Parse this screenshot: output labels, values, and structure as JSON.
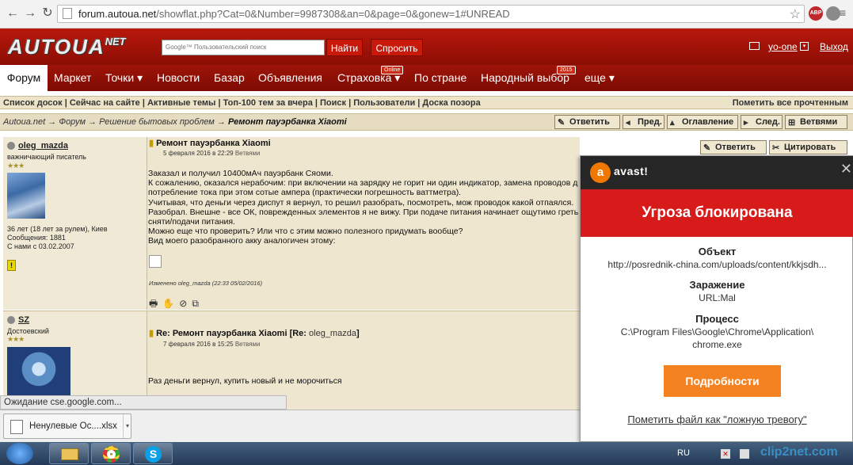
{
  "browser": {
    "url_host": "forum.autoua.net",
    "url_rest": "/showflat.php?Cat=0&Number=9987308&an=0&page=0&gonew=1#UNREAD",
    "ext_abp": "ABP"
  },
  "header": {
    "logo_main": "AUTOUA",
    "logo_sup": "NET",
    "search_placeholder": "Google™ Пользовательский поиск",
    "find_button": "Найти",
    "ask_button": "Спросить",
    "user": "yo-one",
    "logout": "Выход"
  },
  "nav": {
    "items": [
      {
        "label": "Форум"
      },
      {
        "label": "Маркет"
      },
      {
        "label": "Точки ▾"
      },
      {
        "label": "Новости"
      },
      {
        "label": "Базар"
      },
      {
        "label": "Объявления"
      },
      {
        "label": "Страховка ▾",
        "badge": "Online"
      },
      {
        "label": "По стране"
      },
      {
        "label": "Народный выбор",
        "badge": "2015"
      },
      {
        "label": "еще ▾"
      }
    ]
  },
  "linksbar": {
    "left": "Список досок | Сейчас на сайте | Активные темы | Топ-100 тем за вчера | Поиск | Пользователи | Доска позора",
    "right": "Пометить все прочтенным"
  },
  "breadcrumb": {
    "path": "Autoua.net → Форум → Решение бытовых проблем → ",
    "current": "Ремонт пауэрбанка Xiaomi",
    "buttons": [
      "Ответить",
      "Пред.",
      "Оглавление",
      "След.",
      "Ветвями"
    ]
  },
  "post1": {
    "author": "oleg_mazda",
    "rank": "важничающий писатель",
    "info": [
      "36 лет (18 лет за рулем), Киев",
      "Сообщения: 1881",
      "С нами с 03.02.2007"
    ],
    "title": "Ремонт пауэрбанка Xiaomi",
    "date": "5 февраля 2016 в 22:29 ",
    "date_link": "Ветвями",
    "reply_btn": "Ответить",
    "quote_btn": "Цитировать",
    "body": [
      "Заказал и получил 10400мАч пауэрбанк Сяоми.",
      "К сожалению, оказался нерабочим: при включении на зарядку не горит ни один индикатор, замена проводов д",
      "потребление тока при этом сотые ампера (практически погрешность ваттметра).",
      "Учитывая, что деньги через диспут я вернул, то решил разобрать, посмотреть, мож проводок какой отпаялся.",
      "Разобрал. Внешне - все ОК, поврежденных элементов я не вижу. При подаче питания начинает ощутимо греть",
      "сняти/подачи питания.",
      "Можно еще что проверить? Или что с этим можно полезного придумать вообще?",
      "Вид моего разобранного акку аналогичен этому:"
    ],
    "edited": "Изменено oleg_mazda (22:33 05/02/2016)"
  },
  "post2": {
    "author": "SZ",
    "rank": "Достоевский",
    "title": "Re: Ремонт пауэрбанка Xiaomi [Re: ",
    "title_user": "oleg_mazda",
    "title_end": "]",
    "date": "7 февраля 2016 в 15:25 ",
    "date_link": "Ветвями",
    "body": "Раз деньги вернул, купить новый и не морочиться"
  },
  "status": "Ожидание cse.google.com...",
  "download": {
    "filename": "Ненулевые Ос....xlsx"
  },
  "taskbar": {
    "lang": "RU"
  },
  "avast": {
    "brand": "avast!",
    "headline": "Угроза блокирована",
    "object_label": "Объект",
    "object_value": "http://posrednik-china.com/uploads/content/kkjsdh...",
    "infection_label": "Заражение",
    "infection_value": "URL:Mal",
    "process_label": "Процесс",
    "process_value_1": "C:\\Program Files\\Google\\Chrome\\Application\\",
    "process_value_2": "chrome.exe",
    "details_button": "Подробности",
    "false_positive": "Пометить файл как \"ложную тревогу\""
  },
  "watermark": "clip2net.com",
  "colors": {
    "header_red": "#b9180c",
    "avast_red": "#d71a1a",
    "avast_orange": "#f58220",
    "forum_beige": "#efe6cf"
  }
}
